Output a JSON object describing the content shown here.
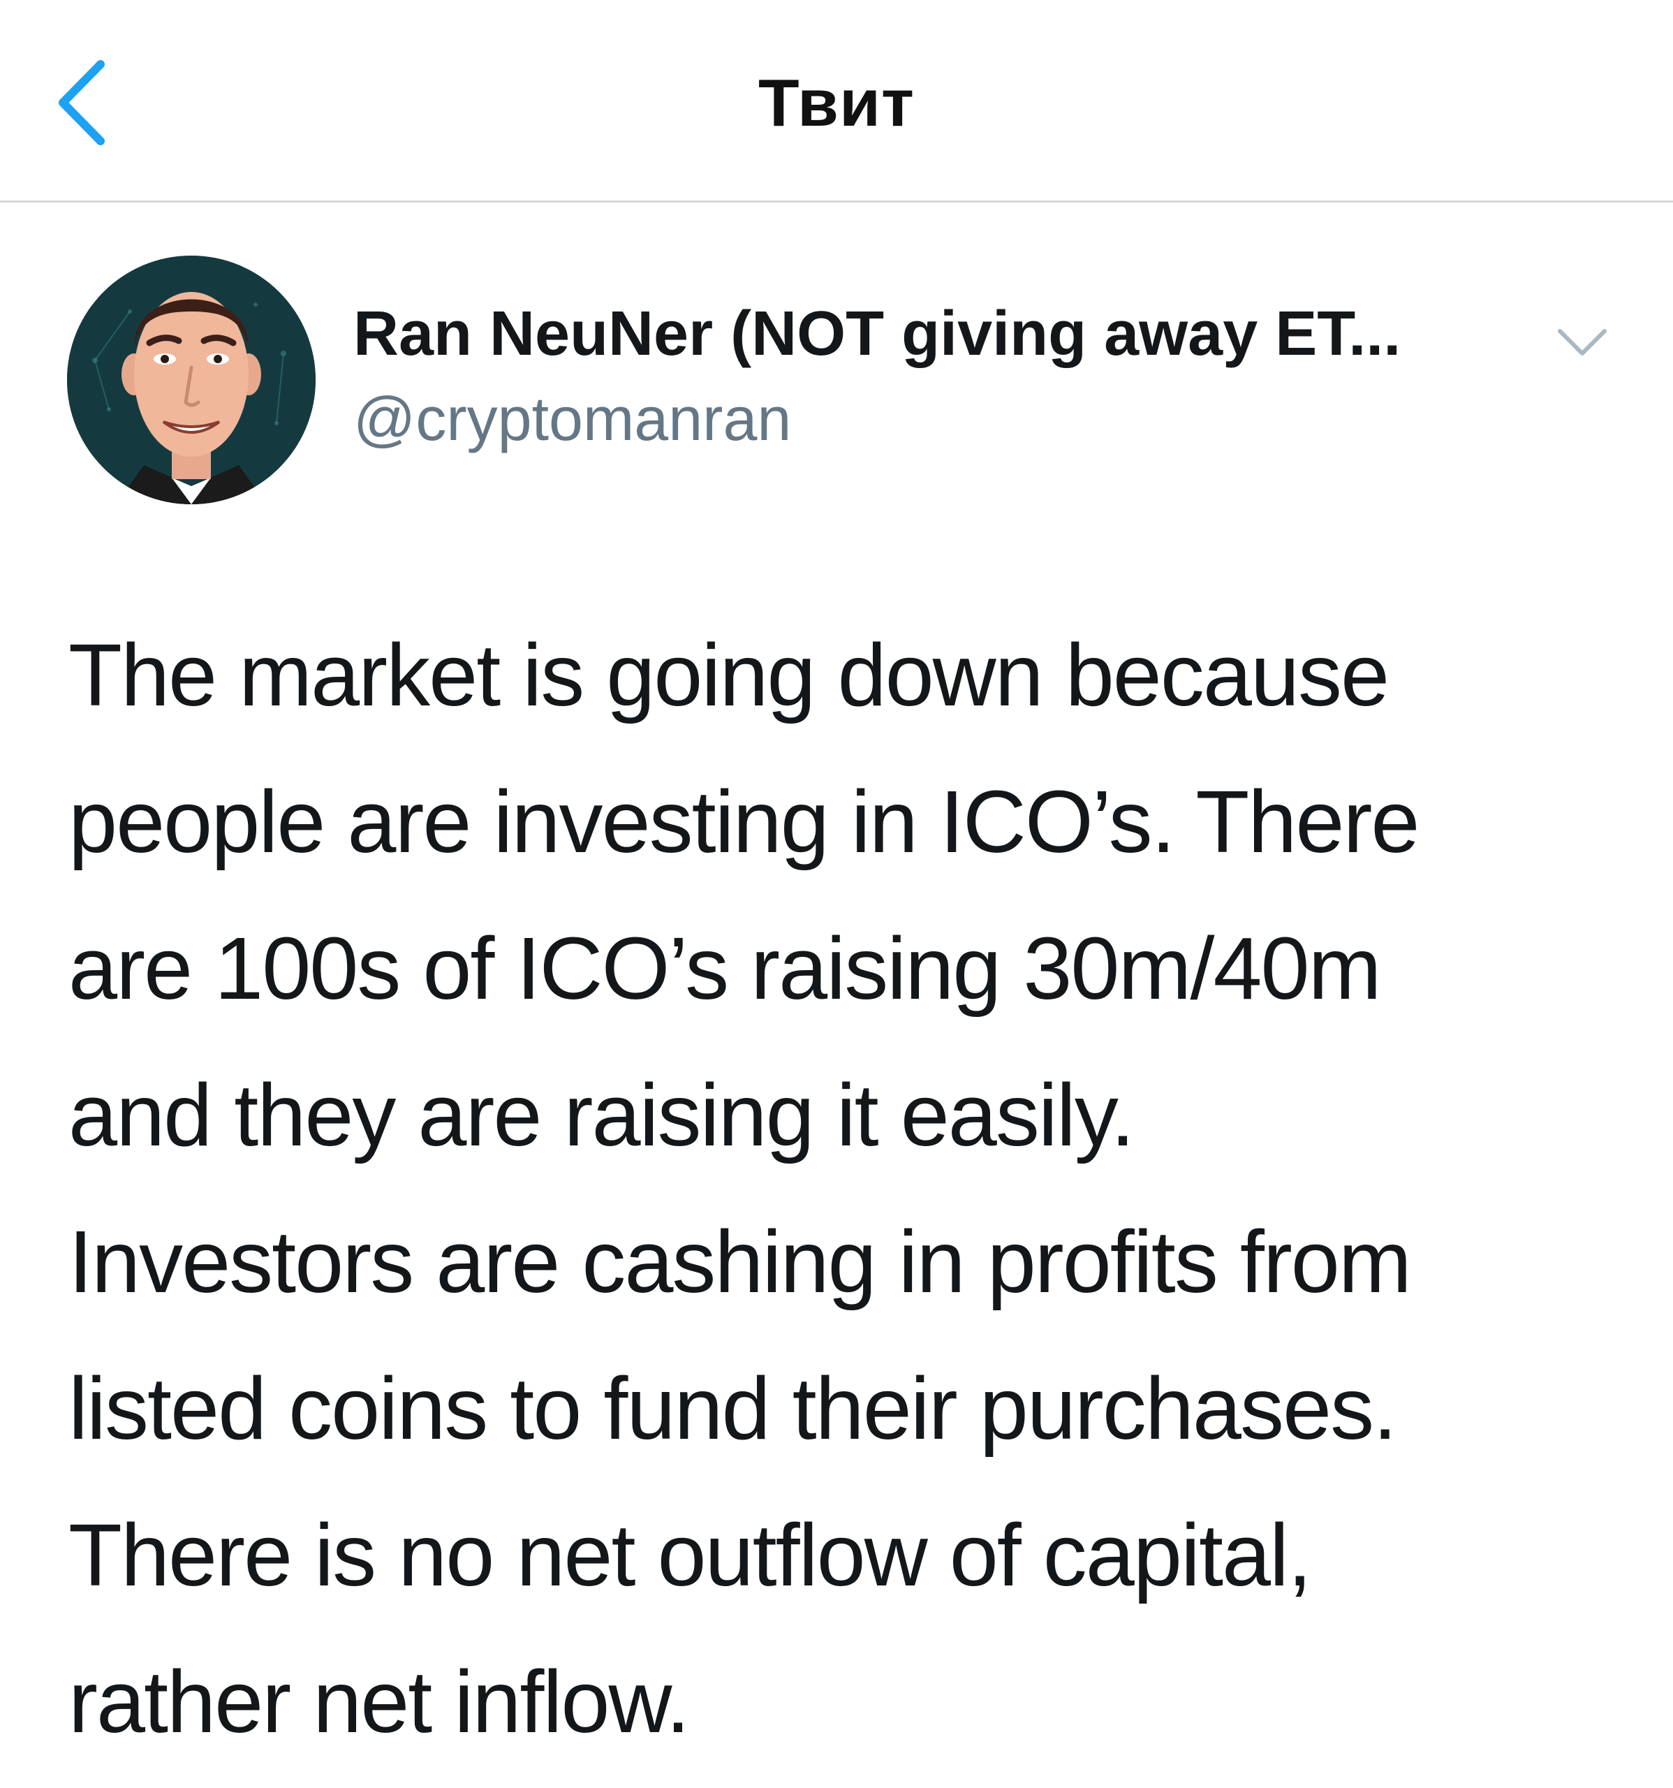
{
  "header": {
    "title": "Твит"
  },
  "icons": {
    "back": "chevron-left-icon",
    "more": "chevron-down-icon",
    "avatar": "cartoon-portrait-avatar"
  },
  "colors": {
    "accent": "#1da1f2",
    "handle_gray": "#657786",
    "text": "#14171a",
    "divider": "#d9d9d9"
  },
  "author": {
    "name": "Ran NeuNer (NOT giving away ET...",
    "handle": "@cryptomanran"
  },
  "tweet": {
    "lines": [
      "The market is going down because",
      "people are investing in ICO’s. There",
      "are 100s of ICO’s raising 30m/40m",
      "and they are raising it easily.",
      "Investors are cashing in profits from",
      "listed coins to fund their purchases.",
      "There is no net outflow of capital,",
      "rather net inflow."
    ]
  }
}
